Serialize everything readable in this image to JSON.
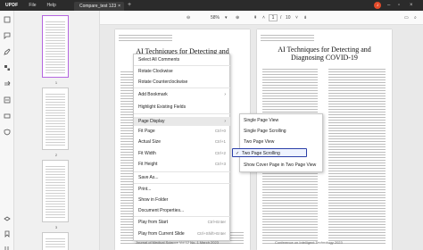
{
  "app": {
    "logo": "UPDF",
    "menu": [
      "File",
      "Help"
    ],
    "tab_title": "Compare_test 123",
    "avatar_letter": "J"
  },
  "thumbnails": {
    "page_numbers": [
      "1",
      "2",
      "3"
    ]
  },
  "toolbar": {
    "zoom": "58%",
    "page_current": "1",
    "page_sep": "/",
    "page_total": "10"
  },
  "document": {
    "page_title_left": "AI Techniques for Detecting and Diagnosing",
    "page_title_right": "AI Techniques for Detecting and Diagnosing COVID-19",
    "footer_left": "Journal of Medical Science Vol 12 No. 1 March 2023",
    "footer_right": "Conference on Intelligent Technology 2023"
  },
  "context_menu": {
    "items": [
      {
        "label": "Select All Comments",
        "shortcut": ""
      },
      {
        "label": "Rotate Clockwise",
        "shortcut": ""
      },
      {
        "label": "Rotate Counterclockwise",
        "shortcut": ""
      },
      {
        "label": "Add Bookmark",
        "shortcut": ""
      },
      {
        "label": "Highlight Existing Fields",
        "shortcut": ""
      },
      {
        "label": "Page Display",
        "shortcut": ""
      },
      {
        "label": "Fit Page",
        "shortcut": "Ctrl+0"
      },
      {
        "label": "Actual Size",
        "shortcut": "Ctrl+1"
      },
      {
        "label": "Fit Width",
        "shortcut": "Ctrl+2"
      },
      {
        "label": "Fit Height",
        "shortcut": "Ctrl+3"
      },
      {
        "label": "Save As...",
        "shortcut": ""
      },
      {
        "label": "Print...",
        "shortcut": ""
      },
      {
        "label": "Show in Folder",
        "shortcut": ""
      },
      {
        "label": "Document Properties...",
        "shortcut": ""
      },
      {
        "label": "Play from Start",
        "shortcut": "Ctrl+Enter"
      },
      {
        "label": "Play from Current Slide",
        "shortcut": "Ctrl+Shift+Enter"
      }
    ]
  },
  "submenu": {
    "items": [
      {
        "label": "Single Page View"
      },
      {
        "label": "Single Page Scrolling"
      },
      {
        "label": "Two Page View"
      },
      {
        "label": "Two Page Scrolling",
        "checked": true
      },
      {
        "label": "Show Cover Page in Two Page View"
      }
    ]
  },
  "colors": {
    "titlebar": "#2b2b2b",
    "accent_purple": "#b566e0",
    "selection_border": "#2b3fa8",
    "avatar": "#e34b2a"
  }
}
